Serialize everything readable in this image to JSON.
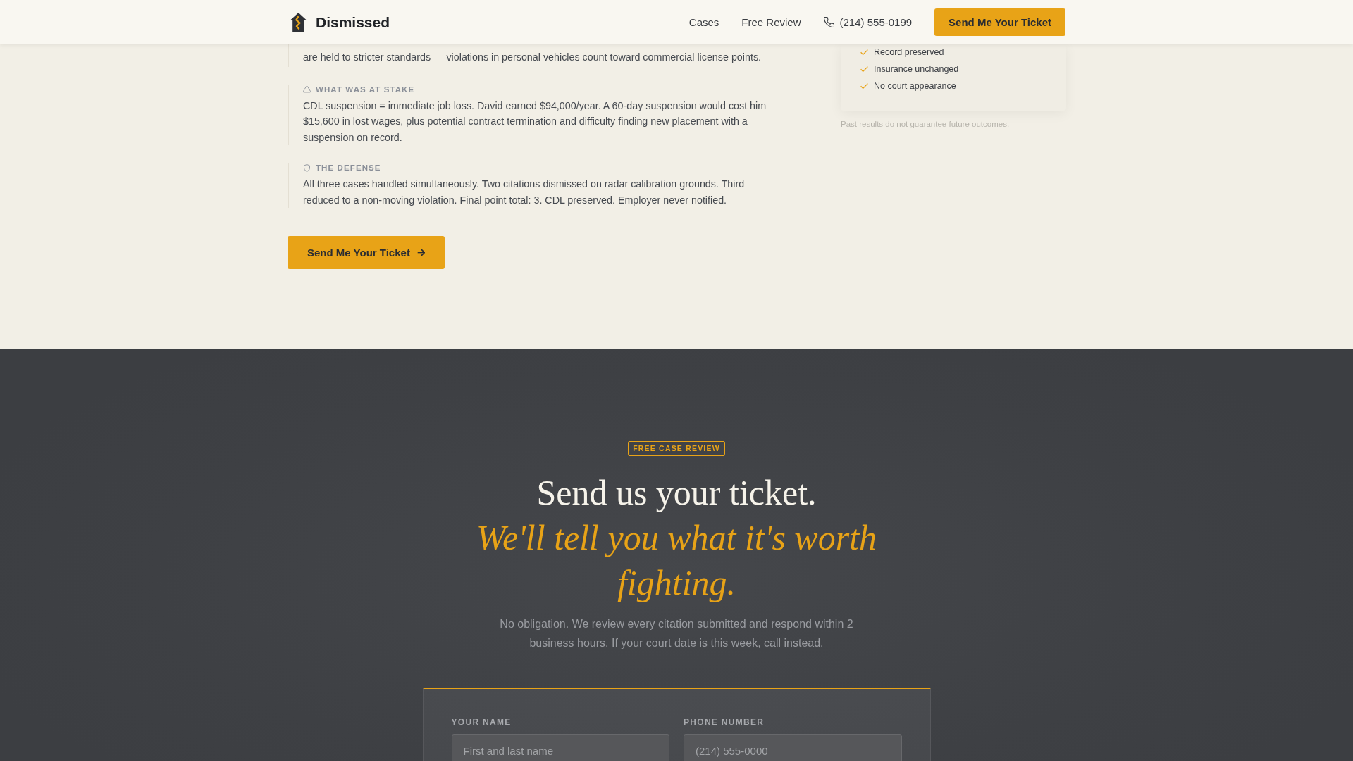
{
  "header": {
    "logo": "Dismissed",
    "nav": [
      {
        "label": "Cases"
      },
      {
        "label": "Free Review"
      }
    ],
    "phone": "(214) 555-0199",
    "cta": "Send Me Your Ticket"
  },
  "case_study": {
    "intro_tail": "are held to stricter standards — violations in personal vehicles count toward commercial license points.",
    "stake": {
      "label": "WHAT WAS AT STAKE",
      "body": "CDL suspension = immediate job loss. David earned $94,000/year. A 60-day suspension would cost him $15,600 in lost wages, plus potential contract termination and difficulty finding new placement with a suspension on record."
    },
    "defense": {
      "label": "THE DEFENSE",
      "body": "All three cases handled simultaneously. Two citations dismissed on radar calibration grounds. Third reduced to a non-moving violation. Final point total: 3. CDL preserved. Employer never notified."
    },
    "button": "Send Me Your Ticket"
  },
  "results_card": {
    "items": [
      "Record preserved",
      "Insurance unchanged",
      "No court appearance"
    ],
    "disclaimer": "Past results do not guarantee future outcomes."
  },
  "review": {
    "badge": "FREE CASE REVIEW",
    "heading": "Send us your ticket.",
    "heading_accent": "We'll tell you what it's worth fighting.",
    "intro": "No obligation. We review every citation submitted and respond within 2 business hours. If your court date is this week, call instead.",
    "form": {
      "fields": [
        {
          "label": "YOUR NAME",
          "placeholder": "First and last name"
        },
        {
          "label": "PHONE NUMBER",
          "placeholder": "(214) 555-0000"
        }
      ]
    }
  }
}
